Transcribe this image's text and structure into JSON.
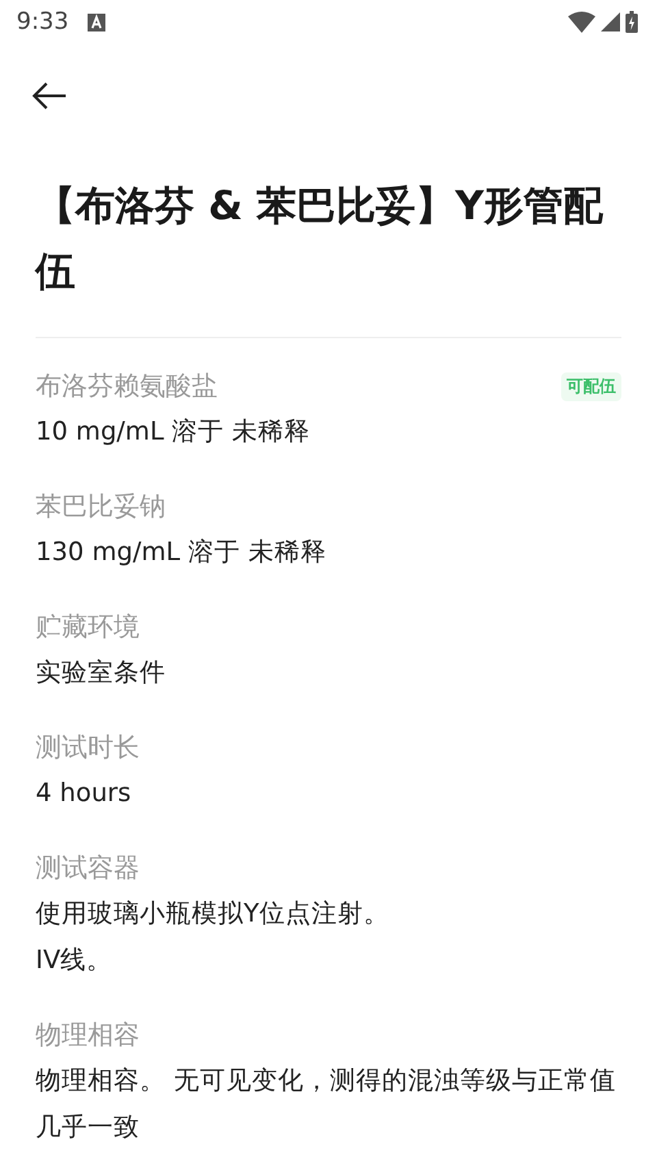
{
  "status_bar": {
    "time": "9:33"
  },
  "title": "【布洛芬 & 苯巴比妥】Y形管配伍",
  "fields": [
    {
      "label": "布洛芬赖氨酸盐",
      "value": "10 mg/mL 溶于 未稀释",
      "badge": "可配伍"
    },
    {
      "label": "苯巴比妥钠",
      "value": "130 mg/mL 溶于 未稀释"
    },
    {
      "label": "贮藏环境",
      "value": "实验室条件"
    },
    {
      "label": "测试时长",
      "value": "4 hours"
    },
    {
      "label": "测试容器",
      "value": "使用玻璃小瓶模拟Y位点注射。\nIV线。"
    },
    {
      "label": "物理相容",
      "value": "物理相容。 无可见变化，测得的混浊等级与正常值几乎一致"
    }
  ]
}
